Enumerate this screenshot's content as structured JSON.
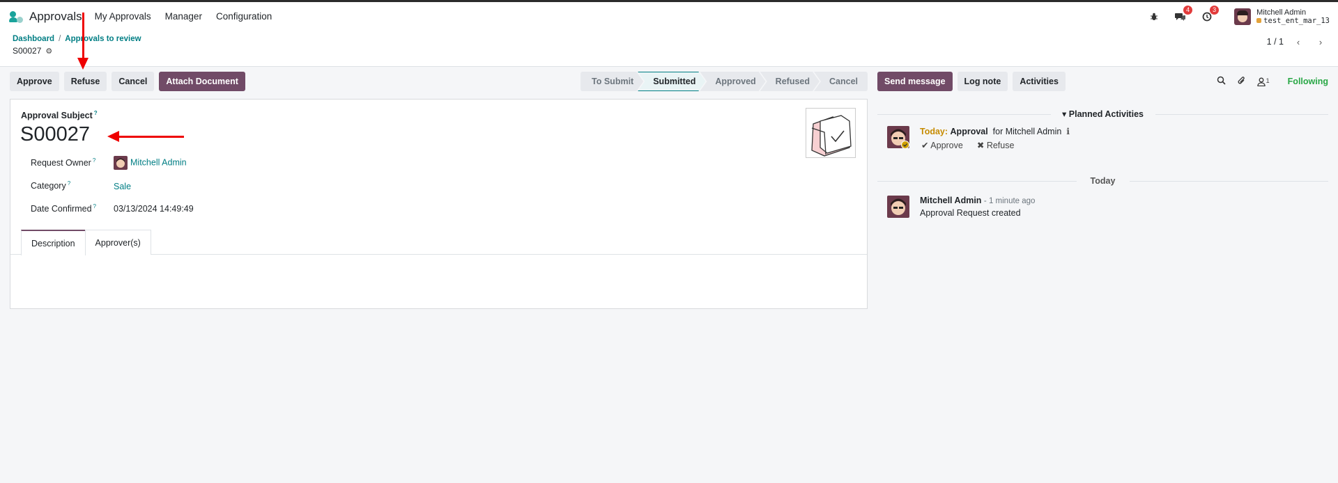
{
  "nav": {
    "app_name": "Approvals",
    "menu": [
      "My Approvals",
      "Manager",
      "Configuration"
    ],
    "messages_count": "4",
    "activities_count": "3",
    "user_name": "Mitchell Admin",
    "database": "test_ent_mar_13"
  },
  "control": {
    "breadcrumb_root": "Dashboard",
    "breadcrumb_parent": "Approvals to review",
    "record": "S00027",
    "pager": "1 / 1"
  },
  "actions": {
    "approve": "Approve",
    "refuse": "Refuse",
    "cancel": "Cancel",
    "attach": "Attach Document"
  },
  "stages": [
    "To Submit",
    "Submitted",
    "Approved",
    "Refused",
    "Cancel"
  ],
  "active_stage": "Submitted",
  "form": {
    "subject_label": "Approval Subject",
    "subject": "S00027",
    "owner_label": "Request Owner",
    "owner": "Mitchell Admin",
    "category_label": "Category",
    "category": "Sale",
    "date_label": "Date Confirmed",
    "date": "03/13/2024 14:49:49",
    "tip": "?",
    "tabs": [
      "Description",
      "Approver(s)"
    ]
  },
  "chatter": {
    "send_message": "Send message",
    "log_note": "Log note",
    "activities": "Activities",
    "followers_count": "1",
    "following": "Following",
    "planned_title": "Planned Activities",
    "activity": {
      "when": "Today:",
      "type": "Approval",
      "for": "for Mitchell Admin",
      "approve": "Approve",
      "refuse": "Refuse"
    },
    "today_sep": "Today",
    "message": {
      "author": "Mitchell Admin",
      "when": "- 1 minute ago",
      "body": "Approval Request created"
    }
  },
  "colors": {
    "brand": "#714b67",
    "accent": "#017e84",
    "annotation": "#e00000"
  }
}
